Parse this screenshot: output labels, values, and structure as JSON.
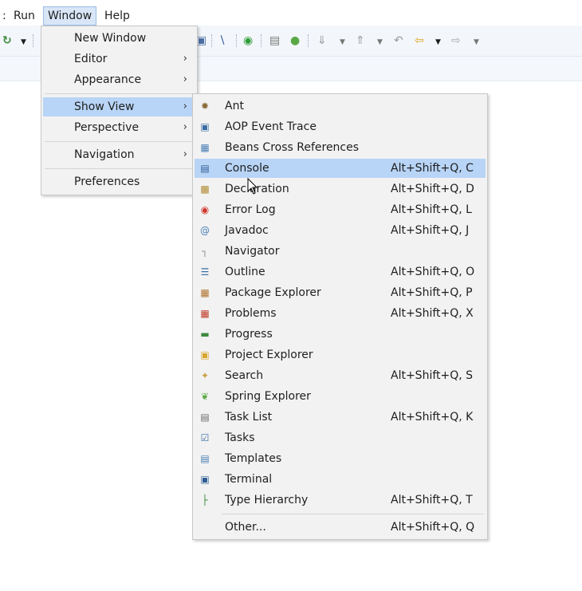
{
  "menubar": {
    "items": [
      {
        "label": ":",
        "key": "cutoff"
      },
      {
        "label": "Run"
      },
      {
        "label": "Window"
      },
      {
        "label": "Help"
      }
    ]
  },
  "window_menu": {
    "items": [
      {
        "label": "New Window"
      },
      {
        "label": "Editor",
        "arrow": "›"
      },
      {
        "label": "Appearance",
        "arrow": "›"
      },
      {
        "label": "Show View",
        "arrow": "›"
      },
      {
        "label": "Perspective",
        "arrow": "›"
      },
      {
        "label": "Navigation",
        "arrow": "›"
      },
      {
        "label": "Preferences"
      }
    ]
  },
  "show_view_menu": {
    "items": [
      {
        "label": "Ant",
        "shortcut": ""
      },
      {
        "label": "AOP Event Trace",
        "shortcut": ""
      },
      {
        "label": "Beans Cross References",
        "shortcut": ""
      },
      {
        "label": "Console",
        "shortcut": "Alt+Shift+Q, C"
      },
      {
        "label": "Declaration",
        "shortcut": "Alt+Shift+Q, D"
      },
      {
        "label": "Error Log",
        "shortcut": "Alt+Shift+Q, L"
      },
      {
        "label": "Javadoc",
        "shortcut": "Alt+Shift+Q, J"
      },
      {
        "label": "Navigator",
        "shortcut": ""
      },
      {
        "label": "Outline",
        "shortcut": "Alt+Shift+Q, O"
      },
      {
        "label": "Package Explorer",
        "shortcut": "Alt+Shift+Q, P"
      },
      {
        "label": "Problems",
        "shortcut": "Alt+Shift+Q, X"
      },
      {
        "label": "Progress",
        "shortcut": ""
      },
      {
        "label": "Project Explorer",
        "shortcut": ""
      },
      {
        "label": "Search",
        "shortcut": "Alt+Shift+Q, S"
      },
      {
        "label": "Spring Explorer",
        "shortcut": ""
      },
      {
        "label": "Task List",
        "shortcut": "Alt+Shift+Q, K"
      },
      {
        "label": "Tasks",
        "shortcut": ""
      },
      {
        "label": "Templates",
        "shortcut": ""
      },
      {
        "label": "Terminal",
        "shortcut": ""
      },
      {
        "label": "Type Hierarchy",
        "shortcut": "Alt+Shift+Q, T"
      },
      {
        "label": "Other...",
        "shortcut": "Alt+Shift+Q, Q"
      }
    ]
  },
  "colors": {
    "highlight": "#b8d4f6",
    "menu_bg": "#f2f2f2",
    "active_menubar": "#d8e6f7"
  }
}
